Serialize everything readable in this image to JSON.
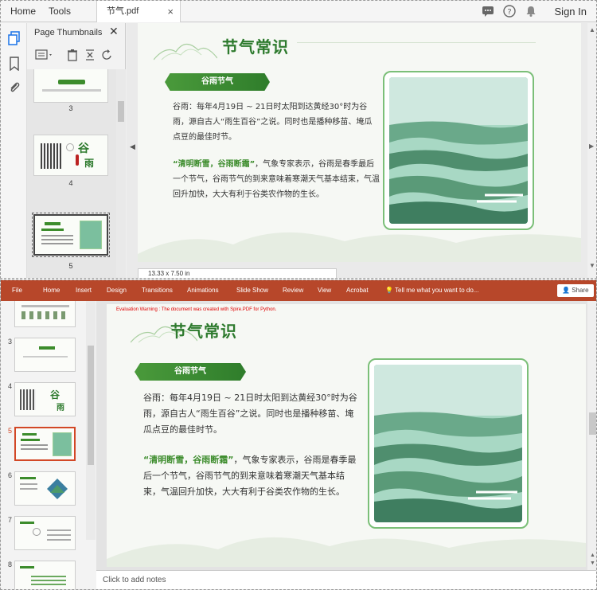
{
  "pdf_viewer": {
    "tabs": {
      "home": "Home",
      "tools": "Tools",
      "document": "节气.pdf",
      "close_glyph": "×"
    },
    "sign_in": "Sign In",
    "thumbnails": {
      "title": "Page Thumbnails",
      "close_glyph": "✕",
      "pages": [
        "3",
        "4",
        "5"
      ]
    },
    "page_size": "13.33 x 7.50 in"
  },
  "powerpoint": {
    "ribbon_tabs": [
      "File",
      "Home",
      "Insert",
      "Design",
      "Transitions",
      "Animations",
      "Slide Show",
      "Review",
      "View",
      "Acrobat"
    ],
    "tell_me": "Tell me what you want to do...",
    "share": "Share",
    "slide_numbers": [
      "3",
      "4",
      "5",
      "6",
      "7",
      "8"
    ],
    "selected_slide": "5",
    "notes_placeholder": "Click to add notes",
    "evaluation_warning": "Evaluation Warning : The document was created with Spire.PDF for Python."
  },
  "slide": {
    "title": "节气常识",
    "section_label": "谷雨节气",
    "para1": "谷雨：每年4月19日 ~ 21日时太阳到达黄经30°时为谷雨，源自古人“雨生百谷”之说。同时也是播种移苗、埯瓜点豆的最佳时节。",
    "para2_highlight": "“清明断雪，谷雨断霜”",
    "para2_rest": "，气象专家表示，谷雨是春季最后一个节气，谷雨节气的到来意味着寒潮天气基本结束，气温回升加快，大大有利于谷类农作物的生长。",
    "thumb4_char1": "谷",
    "thumb4_char2": "雨"
  },
  "colors": {
    "ribbon": "#b7472a",
    "accent_green": "#2d7a2d",
    "selected_slide_border": "#d24726"
  }
}
